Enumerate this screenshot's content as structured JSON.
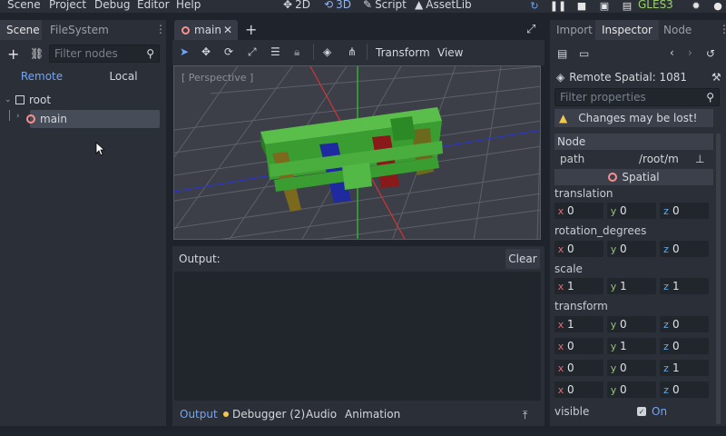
{
  "menu": [
    "Scene",
    "Project",
    "Debug",
    "Editor",
    "Help"
  ],
  "modes": {
    "m2d": "2D",
    "m3d": "3D",
    "script": "Script",
    "assetlib": "AssetLib"
  },
  "renderer": "GLES3",
  "left_dock": {
    "tabs": [
      "Scene",
      "FileSystem"
    ],
    "filter_placeholder": "Filter nodes",
    "remote_label": "Remote",
    "local_label": "Local",
    "tree": [
      {
        "label": "root"
      },
      {
        "label": "main"
      }
    ]
  },
  "scene_tab": {
    "label": "main"
  },
  "viewport": {
    "toolbar_transform": "Transform",
    "toolbar_view": "View",
    "perspective_label": "[ Perspective ]"
  },
  "output": {
    "title": "Output:",
    "clear_label": "Clear",
    "bottom_tabs": [
      "Output",
      "Debugger (2)",
      "Audio",
      "Animation"
    ]
  },
  "inspector": {
    "tabs": [
      "Import",
      "Inspector",
      "Node"
    ],
    "remote_title": "Remote Spatial: 1081",
    "filter_placeholder": "Filter properties",
    "warning": "Changes may be lost!",
    "node_section": "Node",
    "path_label": "path",
    "path_value": "/root/m",
    "spatial_label": "Spatial",
    "translation_label": "translation",
    "translation": {
      "x": "0",
      "y": "0",
      "z": "0"
    },
    "rotation_label": "rotation_degrees",
    "rotation": {
      "x": "0",
      "y": "0",
      "z": "0"
    },
    "scale_label": "scale",
    "scale": {
      "x": "1",
      "y": "1",
      "z": "1"
    },
    "transform_label": "transform",
    "transform_rows": [
      {
        "x": "1",
        "y": "0",
        "z": "0"
      },
      {
        "x": "0",
        "y": "1",
        "z": "0"
      },
      {
        "x": "0",
        "y": "0",
        "z": "1"
      },
      {
        "x": "0",
        "y": "0",
        "z": "0"
      }
    ],
    "visible_label": "visible",
    "visible_value": "On"
  },
  "colors": {
    "accent": "#6ea6ff",
    "panel": "#2b2f37",
    "background": "#1f232b",
    "renderer": "#9ad06e"
  }
}
